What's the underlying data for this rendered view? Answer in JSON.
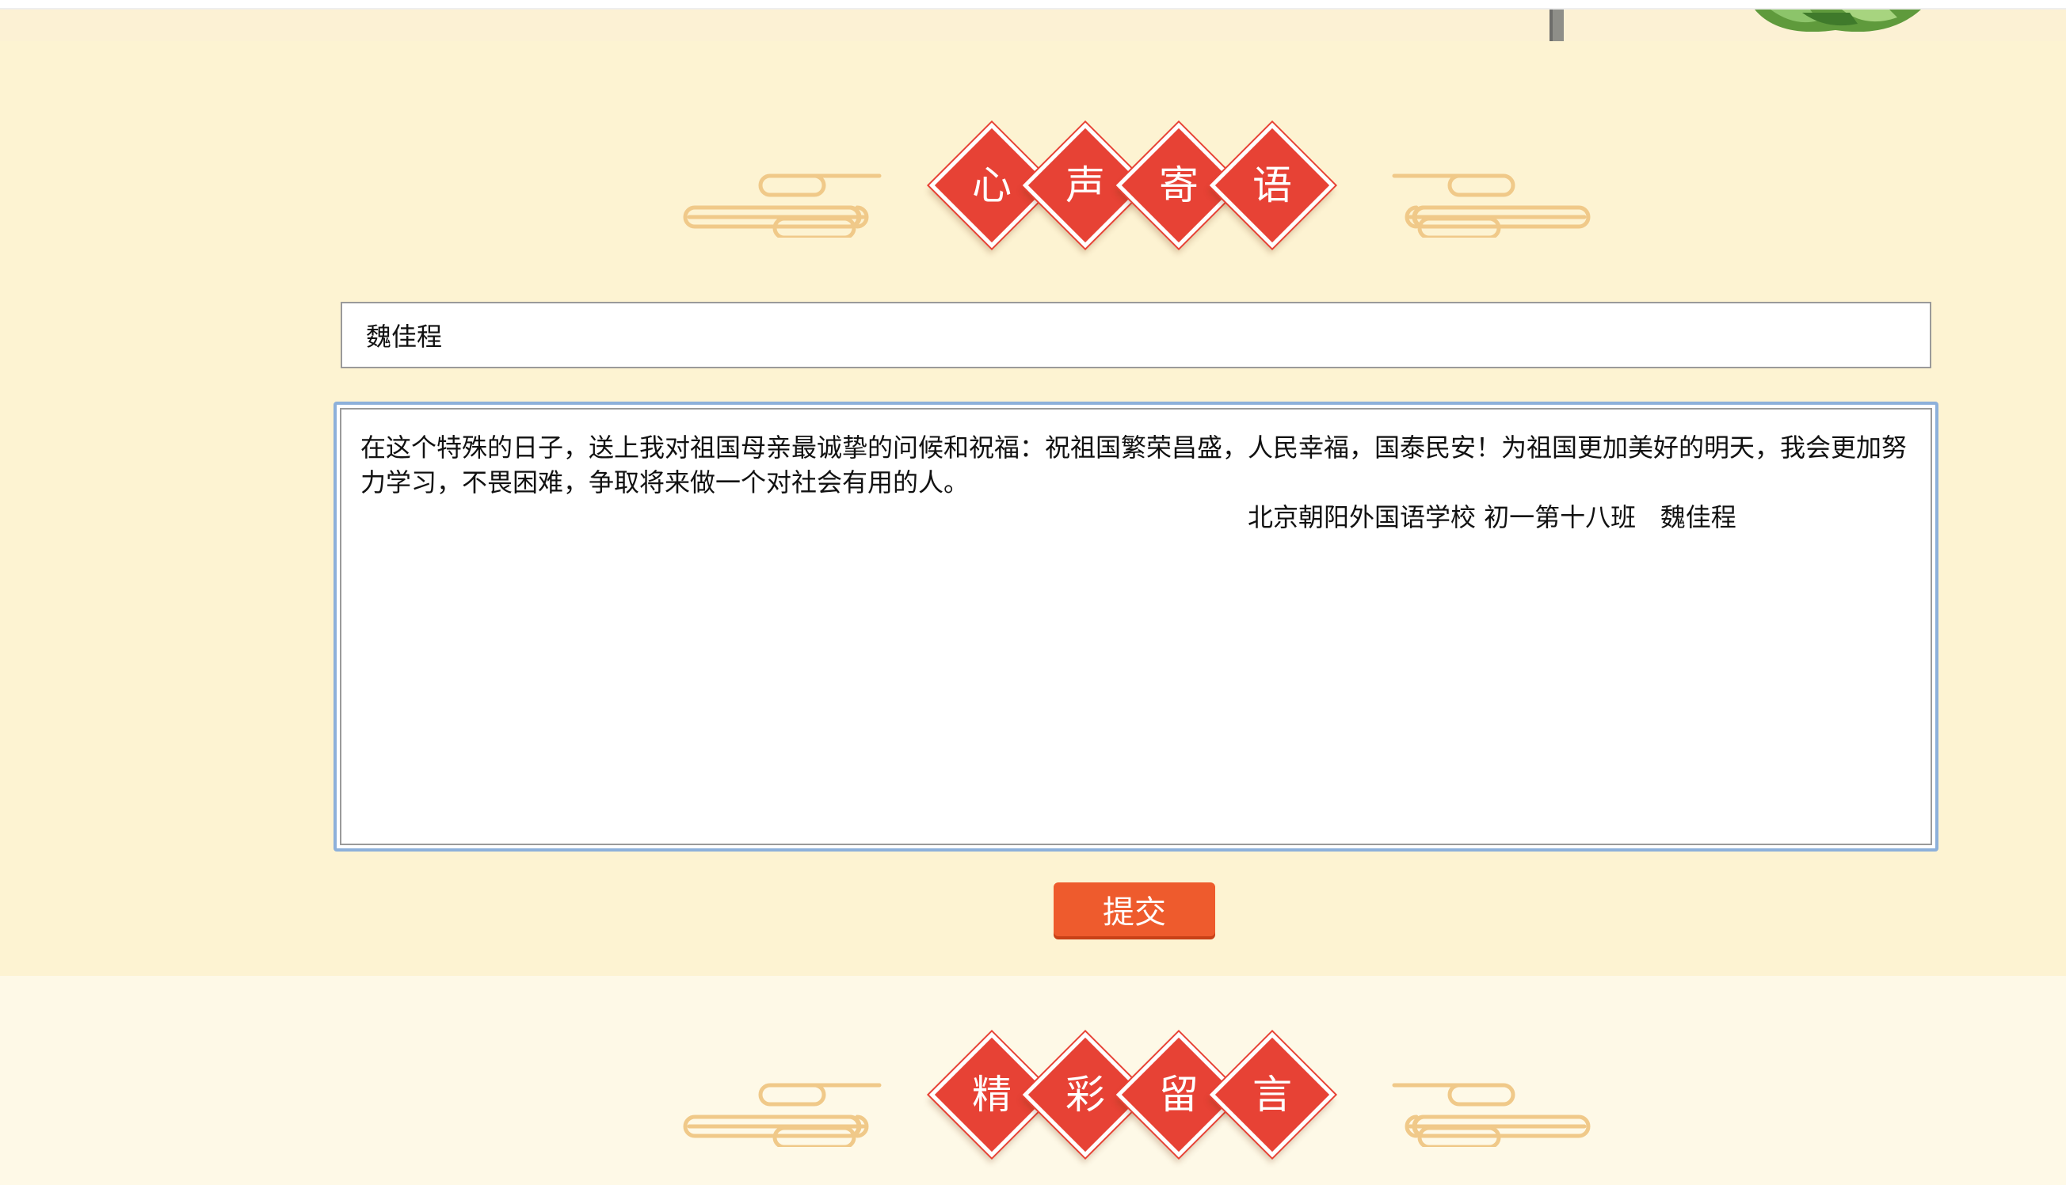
{
  "section_heading": [
    "心",
    "声",
    "寄",
    "语"
  ],
  "form": {
    "name_value": "魏佳程",
    "message_lines": [
      "在这个特殊的日子，送上我对祖国母亲最诚挚的问候和祝福：祝祖国繁荣昌盛，人民幸福，国泰民安！为祖国更加美好的明天，我会更加努",
      "力学习，不畏困难，争取将来做一个对社会有用的人。"
    ],
    "signature": "北京朝阳外国语学校 初一第十八班   魏佳程",
    "submit_label": "提交"
  },
  "messages_heading": [
    "精",
    "彩",
    "留",
    "言"
  ],
  "colors": {
    "page_background": "#fdf3d2",
    "diamond_red": "#e74235",
    "cloud_gold": "#f0c989",
    "submit_orange": "#ee5b2d",
    "focus_border": "#8db0da"
  }
}
